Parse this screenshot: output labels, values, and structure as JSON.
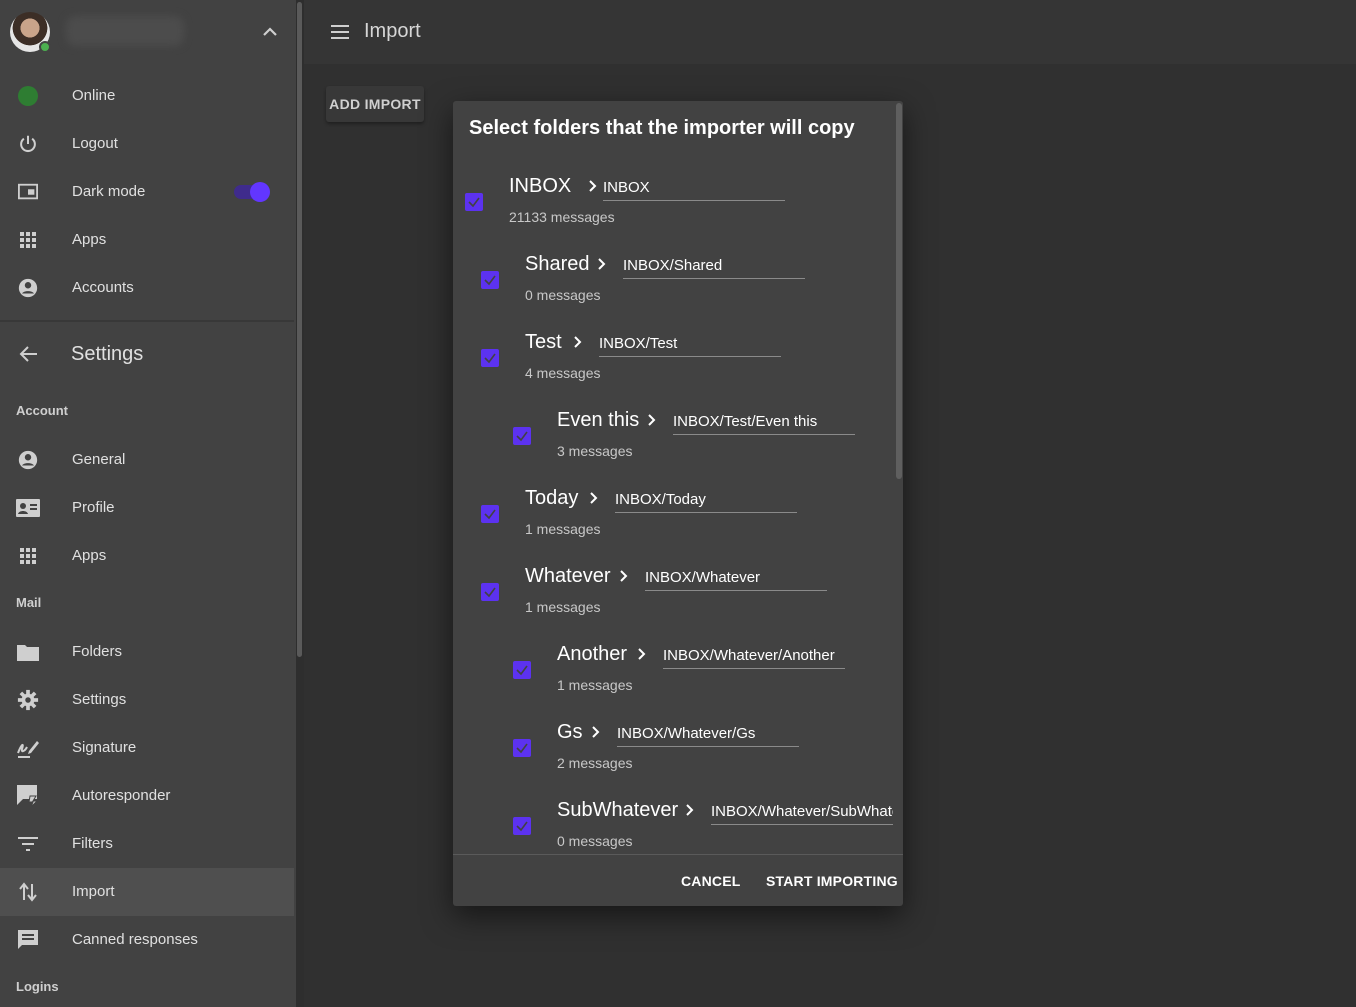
{
  "sidebar": {
    "user_name": "",
    "status_color": "#2e7d32",
    "top_items": [
      {
        "label": "Online"
      },
      {
        "label": "Logout"
      },
      {
        "label": "Dark mode",
        "toggle_on": true
      },
      {
        "label": "Apps"
      },
      {
        "label": "Accounts"
      }
    ],
    "settings_title": "Settings",
    "account_header": "Account",
    "account_items": [
      {
        "label": "General"
      },
      {
        "label": "Profile"
      },
      {
        "label": "Apps"
      }
    ],
    "mail_header": "Mail",
    "mail_items": [
      {
        "label": "Folders"
      },
      {
        "label": "Settings"
      },
      {
        "label": "Signature"
      },
      {
        "label": "Autoresponder"
      },
      {
        "label": "Filters"
      },
      {
        "label": "Import",
        "active": true
      },
      {
        "label": "Canned responses"
      }
    ],
    "logins_header": "Logins"
  },
  "topbar": {
    "title": "Import"
  },
  "add_import_label": "ADD IMPORT",
  "dialog": {
    "title": "Select folders that the importer will copy",
    "folders": [
      {
        "name": "INBOX",
        "count": "21133 messages",
        "target": "INBOX",
        "checked": true
      },
      {
        "name": "Shared",
        "count": "0 messages",
        "target": "INBOX/Shared",
        "checked": true
      },
      {
        "name": "Test",
        "count": "4 messages",
        "target": "INBOX/Test",
        "checked": true
      },
      {
        "name": "Even this",
        "count": "3 messages",
        "target": "INBOX/Test/Even this",
        "checked": true
      },
      {
        "name": "Today",
        "count": "1 messages",
        "target": "INBOX/Today",
        "checked": true
      },
      {
        "name": "Whatever",
        "count": "1 messages",
        "target": "INBOX/Whatever",
        "checked": true
      },
      {
        "name": "Another",
        "count": "1 messages",
        "target": "INBOX/Whatever/Another",
        "checked": true
      },
      {
        "name": "Gs",
        "count": "2 messages",
        "target": "INBOX/Whatever/Gs",
        "checked": true
      },
      {
        "name": "SubWhatever",
        "count": "0 messages",
        "target": "INBOX/Whatever/SubWhatever",
        "checked": true
      }
    ],
    "cancel_label": "CANCEL",
    "start_label": "START IMPORTING"
  },
  "colors": {
    "accent": "#5c32f0",
    "sidebar_bg": "#424242",
    "dialog_bg": "#424242",
    "page_bg": "#303030"
  }
}
